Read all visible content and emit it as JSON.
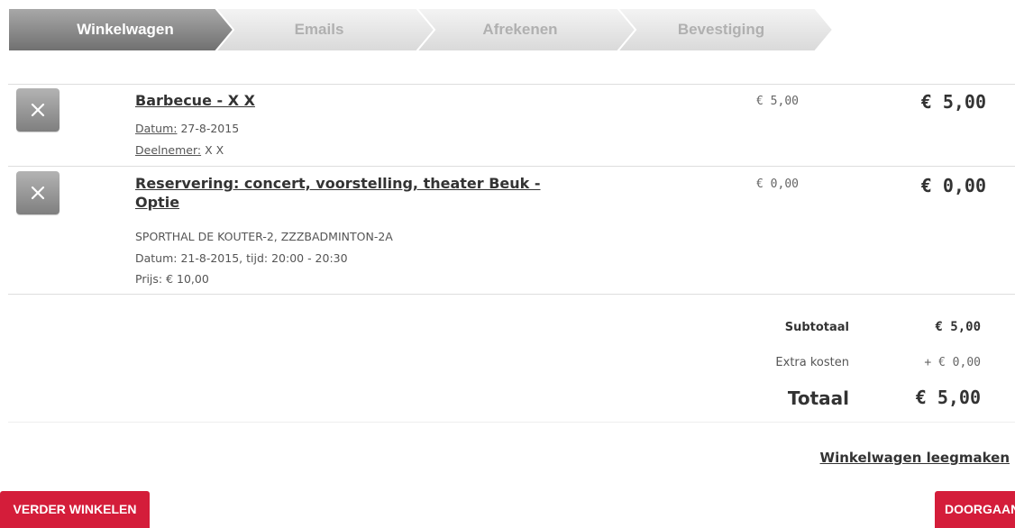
{
  "steps": [
    {
      "label": "Winkelwagen",
      "active": true
    },
    {
      "label": "Emails",
      "active": false
    },
    {
      "label": "Afrekenen",
      "active": false
    },
    {
      "label": "Bevestiging",
      "active": false
    }
  ],
  "cart": {
    "items": [
      {
        "title": "Barbecue - X X",
        "date_label": "Datum:",
        "date_value": " 27-8-2015",
        "participant_label": "Deelnemer:",
        "participant_value": " X X",
        "unit_price": "€ 5,00",
        "total": "€ 5,00"
      },
      {
        "title_line1": "Reservering: concert, voorstelling, theater Beuk -",
        "title_line2": "Optie",
        "location": "SPORTHAL DE KOUTER-2, ZZZBADMINTON-2A",
        "datetime": "Datum: 21-8-2015, tijd: 20:00 - 20:30",
        "price_text": "Prijs: € 10,00",
        "unit_price": "€ 0,00",
        "total": "€ 0,00"
      }
    ]
  },
  "totals": {
    "subtotal_label": "Subtotaal",
    "subtotal_value": "€ 5,00",
    "extra_label": "Extra kosten",
    "extra_value": "+ € 0,00",
    "total_label": "Totaal",
    "total_value": "€ 5,00"
  },
  "actions": {
    "empty_cart": "Winkelwagen leegmaken",
    "continue_shopping": "VERDER WINKELEN",
    "proceed": "DOORGAAN"
  },
  "icons": {
    "remove": "close-icon"
  },
  "colors": {
    "accent_red": "#d41d3a",
    "step_active": "#8a8a8a",
    "step_inactive": "#e6e6e6"
  }
}
